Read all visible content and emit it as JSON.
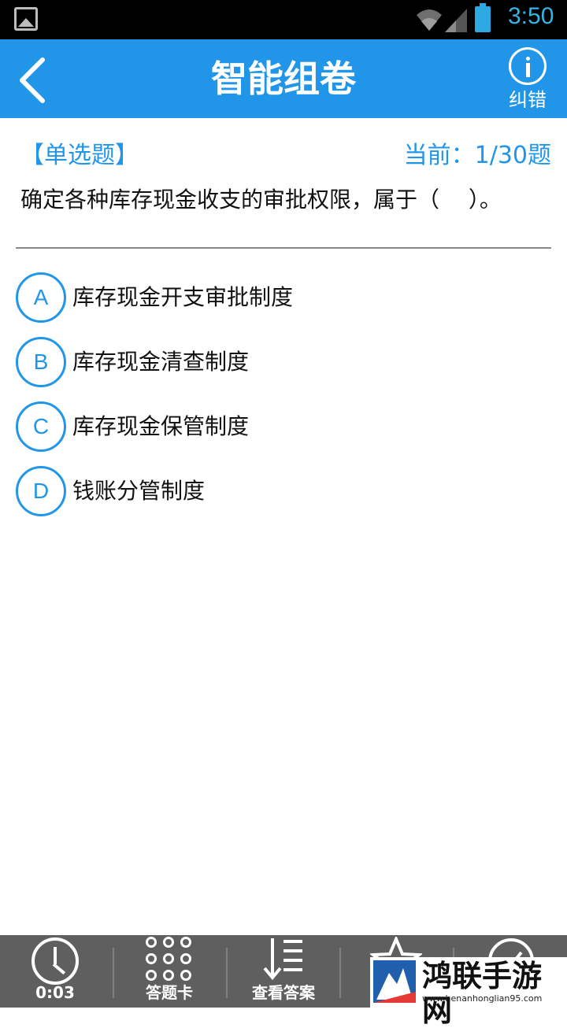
{
  "status_bar": {
    "time": "3:50",
    "colors": {
      "accent": "#33b5e5"
    }
  },
  "header": {
    "title": "智能组卷",
    "report_label": "纠错",
    "background": "#2196e9"
  },
  "question": {
    "type_label": "【单选题】",
    "progress": "当前：1/30题",
    "text": "确定各种库存现金收支的审批权限，属于（　 ）。",
    "options": [
      {
        "letter": "A",
        "text": "库存现金开支审批制度"
      },
      {
        "letter": "B",
        "text": "库存现金清查制度"
      },
      {
        "letter": "C",
        "text": "库存现金保管制度"
      },
      {
        "letter": "D",
        "text": "钱账分管制度"
      }
    ]
  },
  "toolbar": {
    "timer": "0:03",
    "answer_card": "答题卡",
    "view_answer": "查看答案"
  },
  "watermark": {
    "title": "鸿联手游网",
    "url": "www.henanhonglian95.com"
  }
}
